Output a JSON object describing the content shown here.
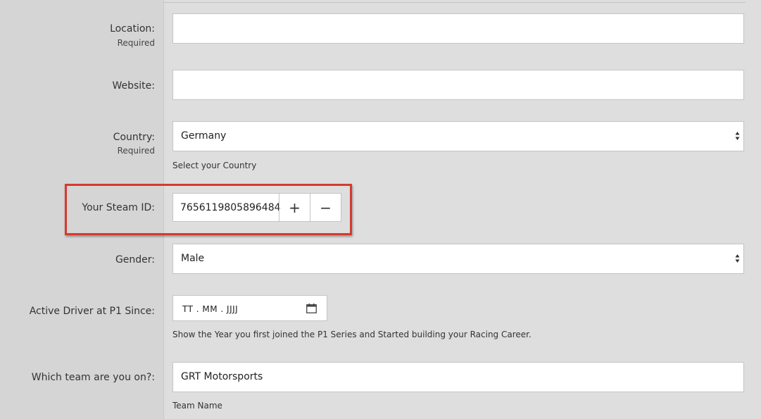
{
  "form": {
    "location": {
      "label": "Location:",
      "required": "Required",
      "value": ""
    },
    "website": {
      "label": "Website:",
      "value": ""
    },
    "country": {
      "label": "Country:",
      "required": "Required",
      "value": "Germany",
      "help": "Select your Country"
    },
    "steam_id": {
      "label": "Your Steam ID:",
      "value": "7656119805896484",
      "increment": "+",
      "decrement": "−"
    },
    "gender": {
      "label": "Gender:",
      "value": "Male"
    },
    "active_since": {
      "label": "Active Driver at P1 Since:",
      "placeholder": "TT . MM . JJJJ",
      "help": "Show the Year you first joined the P1 Series and Started building your Racing Career."
    },
    "team": {
      "label": "Which team are you on?:",
      "value": "GRT Motorsports",
      "help": "Team Name"
    }
  },
  "icons": {
    "select_arrows": "updown-arrows-icon",
    "calendar": "calendar-icon"
  },
  "colors": {
    "highlight": "#d63a2e"
  }
}
